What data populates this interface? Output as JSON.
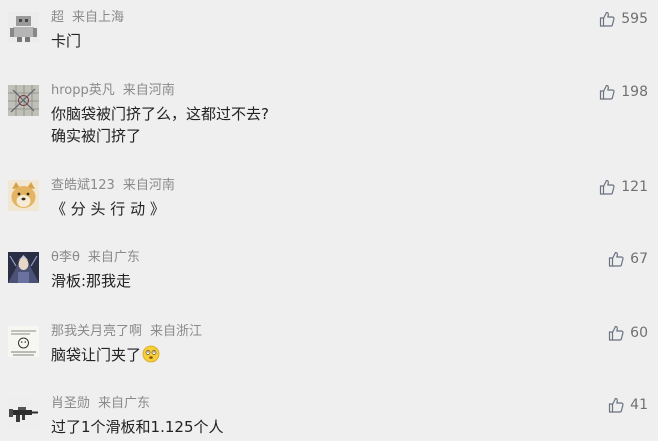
{
  "comments": [
    {
      "user": "超",
      "location": "来自上海",
      "lines": [
        "卡门"
      ],
      "likes": "595",
      "avatar_icon": "robot-avatar"
    },
    {
      "user": "hropp英凡",
      "location": "来自河南",
      "lines": [
        "你脑袋被门挤了么，这都过不去?",
        "确实被门挤了"
      ],
      "likes": "198",
      "avatar_icon": "grid-pattern-avatar"
    },
    {
      "user": "查皓斌123",
      "location": "来自河南",
      "lines": [
        "《 分 头 行 动 》"
      ],
      "likes": "121",
      "avatar_icon": "shiba-dog-avatar"
    },
    {
      "user": "θ李θ",
      "location": "来自广东",
      "lines": [
        "滑板:那我走"
      ],
      "likes": "67",
      "avatar_icon": "anime-character-avatar"
    },
    {
      "user": "那我关月亮了啊",
      "location": "来自浙江",
      "lines": [
        "脑袋让门夹了"
      ],
      "likes": "60",
      "avatar_icon": "sketch-meme-avatar",
      "emoji": "dizzy-face-emoji"
    },
    {
      "user": "肖圣勋",
      "location": "来自广东",
      "lines": [
        "过了1个滑板和1.125个人"
      ],
      "likes": "41",
      "avatar_icon": "rifle-avatar"
    }
  ],
  "colors": {
    "background": "#efefef",
    "meta_text": "#8a8a8a",
    "content_text": "#222222",
    "like_text": "#707070"
  },
  "like_icon": "thumbs-up-icon"
}
